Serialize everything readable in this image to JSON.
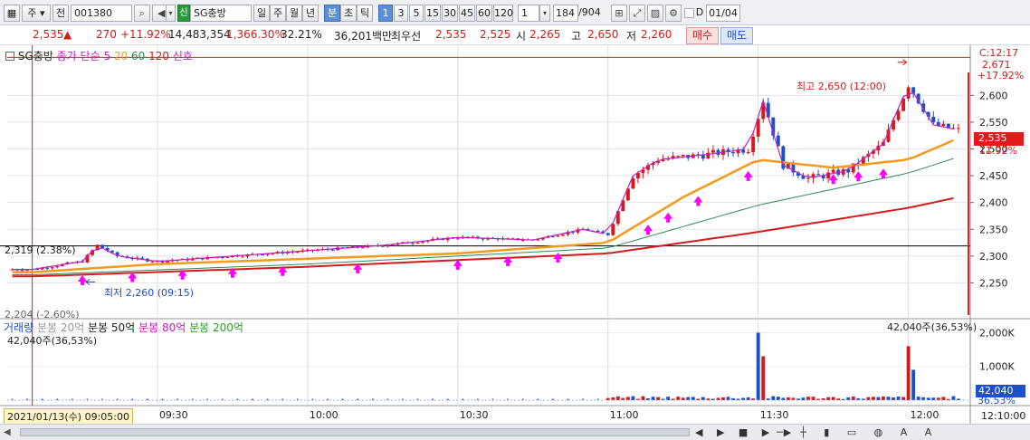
{
  "toolbar": {
    "market_type": "주",
    "market_type_suffix": "전",
    "code": "001380",
    "search_icon": "search-icon",
    "stock_name_badge": "신",
    "stock_name": "SG충방",
    "period_tabs": [
      "일",
      "주",
      "월",
      "년",
      "분",
      "초",
      "틱"
    ],
    "selected_period": "분",
    "interval_buttons": [
      "1",
      "3",
      "5",
      "15",
      "30",
      "45",
      "60",
      "120"
    ],
    "selected_interval": "1",
    "interval_value": "1",
    "count_value": "184",
    "count_total": "/904",
    "checkbox_label": "D",
    "date_value": "01/04"
  },
  "quote": {
    "price": "2,535",
    "direction": "▲",
    "change": "270",
    "change_pct": "+11.92%",
    "volume": "14,483,354",
    "volume_pct": "1,366.30%",
    "turnover_pct": "32.21%",
    "amount": "36,201백만",
    "best_bid_label": "최우선",
    "best_ask": "2,535",
    "best_bid": "2,525",
    "open_label": "시",
    "open": "2,265",
    "high_label": "고",
    "high": "2,650",
    "low_label": "저",
    "low": "2,260",
    "buy_button": "매수",
    "sell_button": "매도"
  },
  "price_legend": {
    "name": "SG충방",
    "ma_label": "종가 단순",
    "ma_periods": [
      "5",
      "20",
      "60",
      "120"
    ],
    "signal_label": "신호",
    "colors": {
      "ma5": "#c020c0",
      "ma20": "#f59a1e",
      "ma60": "#2e8b57",
      "ma120": "#d41b1b"
    }
  },
  "price_annotations": {
    "high": "최고 2,650 (12:00)",
    "low": "최저 2,260 (09:15)",
    "ref_line_label": "2,319 (2.38%)",
    "ref_bottom_label": "2,204 (-2.60%)"
  },
  "volume_legend": {
    "title": "거래량",
    "items": [
      "분봉 20억",
      "분봉 50억",
      "분봉 80억",
      "분봉 200억"
    ],
    "last_value_left": "42,040주(36,53%)",
    "last_value_right": "42,040주(36,53%)"
  },
  "price_axis": {
    "ticks": [
      "2,600",
      "2,550",
      "2,500",
      "2,450",
      "2,400",
      "2,350",
      "2,300",
      "2,250"
    ],
    "time_label": "C:12:17",
    "top_value": "2,671",
    "top_pct": "+17.92%",
    "current_value": "2,535",
    "current_pct": "11.92%"
  },
  "volume_axis": {
    "ticks": [
      "2,000K",
      "1,000K"
    ],
    "current_value": "42,040",
    "current_pct": "36.53%"
  },
  "time_axis": {
    "cursor_label": "2021/01/13(수) 09:05:00",
    "ticks": [
      "09:30",
      "10:00",
      "10:30",
      "11:00",
      "11:30",
      "12:00"
    ],
    "end_label": "12:10:00"
  },
  "colors": {
    "up": "#d41b1b",
    "down": "#1d4fc9",
    "signal": "#ff00ff",
    "accent": "#5b8fd8"
  },
  "chart_data": {
    "type": "candlestick",
    "title": "SG충방",
    "interval": "1분",
    "price_ylim": [
      2200,
      2680
    ],
    "volume_ylim": [
      0,
      2200000
    ],
    "x_ticks": [
      "09:30",
      "10:00",
      "10:30",
      "11:00",
      "11:30",
      "12:00"
    ],
    "close_path": [
      {
        "t": "09:05",
        "p": 2275
      },
      {
        "t": "09:15",
        "p": 2290
      },
      {
        "t": "09:18",
        "p": 2320
      },
      {
        "t": "09:22",
        "p": 2300
      },
      {
        "t": "09:30",
        "p": 2290
      },
      {
        "t": "09:45",
        "p": 2300
      },
      {
        "t": "10:00",
        "p": 2310
      },
      {
        "t": "10:15",
        "p": 2320
      },
      {
        "t": "10:30",
        "p": 2335
      },
      {
        "t": "10:45",
        "p": 2330
      },
      {
        "t": "10:55",
        "p": 2350
      },
      {
        "t": "11:00",
        "p": 2340
      },
      {
        "t": "11:05",
        "p": 2450
      },
      {
        "t": "11:10",
        "p": 2480
      },
      {
        "t": "11:20",
        "p": 2490
      },
      {
        "t": "11:28",
        "p": 2500
      },
      {
        "t": "11:31",
        "p": 2590
      },
      {
        "t": "11:35",
        "p": 2470
      },
      {
        "t": "11:40",
        "p": 2445
      },
      {
        "t": "11:48",
        "p": 2460
      },
      {
        "t": "11:55",
        "p": 2510
      },
      {
        "t": "12:00",
        "p": 2620
      },
      {
        "t": "12:05",
        "p": 2545
      },
      {
        "t": "12:10",
        "p": 2535
      }
    ],
    "ma20": [
      {
        "t": "09:05",
        "p": 2270
      },
      {
        "t": "09:30",
        "p": 2285
      },
      {
        "t": "10:00",
        "p": 2295
      },
      {
        "t": "10:30",
        "p": 2305
      },
      {
        "t": "11:00",
        "p": 2325
      },
      {
        "t": "11:15",
        "p": 2410
      },
      {
        "t": "11:30",
        "p": 2480
      },
      {
        "t": "11:45",
        "p": 2465
      },
      {
        "t": "12:00",
        "p": 2480
      },
      {
        "t": "12:10",
        "p": 2520
      }
    ],
    "ma60": [
      {
        "t": "09:05",
        "p": 2265
      },
      {
        "t": "10:00",
        "p": 2285
      },
      {
        "t": "11:00",
        "p": 2315
      },
      {
        "t": "11:30",
        "p": 2395
      },
      {
        "t": "12:00",
        "p": 2455
      },
      {
        "t": "12:10",
        "p": 2485
      }
    ],
    "ma120": [
      {
        "t": "09:05",
        "p": 2262
      },
      {
        "t": "10:00",
        "p": 2280
      },
      {
        "t": "11:00",
        "p": 2305
      },
      {
        "t": "11:30",
        "p": 2345
      },
      {
        "t": "12:00",
        "p": 2390
      },
      {
        "t": "12:10",
        "p": 2410
      }
    ],
    "high": {
      "t": "12:00",
      "p": 2650
    },
    "low": {
      "t": "09:15",
      "p": 2260
    },
    "ref_line": 2319,
    "volume_peaks": [
      {
        "t": "11:30",
        "v": 2000000
      },
      {
        "t": "11:31",
        "v": 1300000
      },
      {
        "t": "12:00",
        "v": 1600000
      },
      {
        "t": "12:01",
        "v": 900000
      },
      {
        "t": "12:10",
        "v": 42040
      }
    ]
  }
}
